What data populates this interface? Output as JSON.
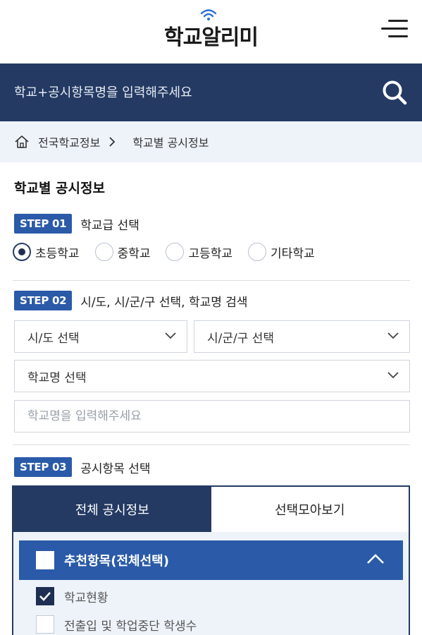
{
  "header": {
    "logo_text": "학교알리미",
    "menu_icon": "hamburger-icon"
  },
  "search": {
    "placeholder": "학교+공시항목명을 입력해주세요",
    "value": "",
    "icon": "search-icon"
  },
  "breadcrumb": {
    "items": [
      "전국학교정보",
      "학교별 공시정보"
    ]
  },
  "page": {
    "title": "학교별 공시정보"
  },
  "step1": {
    "badge": "STEP 01",
    "label": "학교급 선택",
    "options": [
      "초등학교",
      "중학교",
      "고등학교",
      "기타학교"
    ],
    "selected_index": 0
  },
  "step2": {
    "badge": "STEP 02",
    "label": "시/도, 시/군/구 선택, 학교명 검색",
    "sido_select": "시/도 선택",
    "sigungu_select": "시/군/구 선택",
    "school_select": "학교명 선택",
    "school_input_placeholder": "학교명을 입력해주세요"
  },
  "step3": {
    "badge": "STEP 03",
    "label": "공시항목 선택",
    "tabs": [
      "전체 공시정보",
      "선택모아보기"
    ],
    "active_tab": 0,
    "group_label": "추천항목(전체선택)",
    "group_checked": false,
    "items": [
      {
        "label": "학교현황",
        "checked": true
      },
      {
        "label": "전출입 및 학업중단 학생수",
        "checked": false
      }
    ]
  },
  "colors": {
    "navy": "#243a63",
    "accent_blue": "#2a5aa8",
    "breadcrumb_bg": "#eef3fa"
  }
}
